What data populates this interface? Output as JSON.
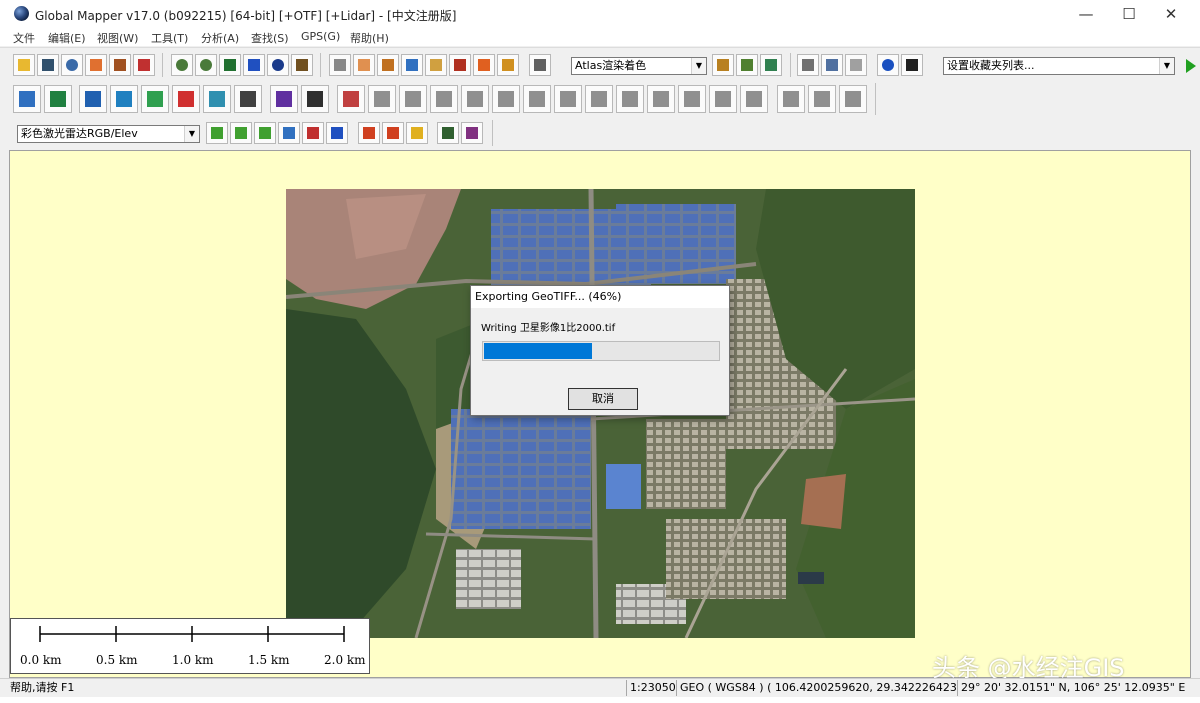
{
  "window": {
    "title": "Global Mapper v17.0 (b092215) [64-bit] [+OTF] [+Lidar] - [中文注册版]",
    "minimize_glyph": "—",
    "maximize_glyph": "☐",
    "close_glyph": "✕"
  },
  "menu": [
    "文件",
    "编辑(E)",
    "视图(W)",
    "工具(T)",
    "分析(A)",
    "查找(S)",
    "GPS(G)",
    "帮助(H)"
  ],
  "toolbar": {
    "shader_combo": "Atlas渲染着色",
    "favorites_combo": "设置收藏夹列表...",
    "lidar_combo": "彩色激光雷达RGB/Elev"
  },
  "dialog": {
    "title": "Exporting GeoTIFF... (46%)",
    "message": "Writing 卫星影像1比2000.tif",
    "progress": 0.46,
    "cancel_label": "取消"
  },
  "scale_bar": [
    "0.0 km",
    "0.5 km",
    "1.0 km",
    "1.5 km",
    "2.0 km"
  ],
  "status": {
    "help": "帮助,请按 F1",
    "scale": "1:23050",
    "projection": "GEO ( WGS84 ) ( 106.4200259620, 29.3422264234 )",
    "dms": "29° 20' 32.0151\" N, 106° 25' 12.0935\" E"
  },
  "watermark": "头条 @水经注GIS",
  "colors": {
    "map_background": "#ffffc8",
    "progress_fill": "#0078d7"
  }
}
